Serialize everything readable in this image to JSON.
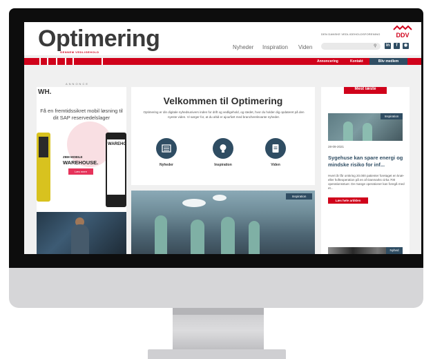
{
  "header": {
    "logo": "Optimering",
    "logo_sub": "GENNEM VEDLIGEHOLD",
    "nav": [
      "Nyheder",
      "Inspiration",
      "Viden"
    ],
    "association": "DEN DANSKE VEDLIGEHOLDSFORENING",
    "brand_logo": "DDV",
    "search_placeholder": "",
    "social_icons": [
      "linkedin-icon",
      "facebook-icon",
      "instagram-icon"
    ]
  },
  "topnav": {
    "links": [
      "Annoncering",
      "Kontakt"
    ],
    "member_button": "Bliv medlem"
  },
  "ad": {
    "label": "ANNONCE",
    "logo": "WH.",
    "text": "Få en fremtidssikret mobil løsning til dit SAP reservedelslager",
    "headline_1": "ZBM MOBILE",
    "headline_2": "WAREHOUSE.",
    "button": "Læs mere",
    "phone_text": "WAREHO"
  },
  "welcome": {
    "title": "Velkommen til Optimering",
    "description": "Optimering er din digitale nyhedsunivers inden for drift og vedligehold, og stedet, hvor du holder dig opdateret på den nyeste viden. Vi sørger for, at du altid er ajourført med brancherelevante nyheder.",
    "categories": [
      {
        "label": "Nyheder",
        "icon": "newspaper-icon"
      },
      {
        "label": "Inspiration",
        "icon": "lightbulb-icon"
      },
      {
        "label": "Viden",
        "icon": "book-icon"
      }
    ]
  },
  "feature_tag": "Inspiration",
  "sidebar": {
    "heading": "Mest læste",
    "item_tag": "Inspiration",
    "date": "28-09-2021",
    "title": "Sygehuse kan spare energi og mindske risiko for inf...",
    "description": "Hvert år får omkring 20.000 patienter foretaget en knæ- eller hofteoperation på en af Danmarks cirka 700 operationsstuer. De mange operationer kan foregå med et...",
    "button": "Læs hele artiklen",
    "next_tag": "Nyhed"
  },
  "colors": {
    "brand_red": "#d0021b",
    "navy": "#2f4d63"
  }
}
